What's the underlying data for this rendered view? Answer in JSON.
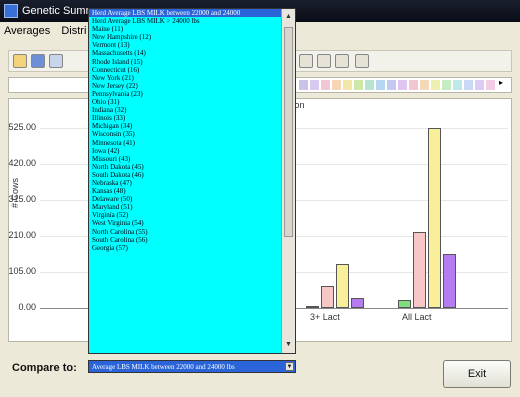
{
  "window": {
    "title": "Genetic Summ"
  },
  "menubar": {
    "items": [
      "Averages",
      "Distri"
    ]
  },
  "chart_data": {
    "type": "bar",
    "subtitle": "tion",
    "ylabel": "# Cows",
    "yticks": [
      "525.00",
      "420.00",
      "315.00",
      "210.00",
      "105.00",
      "0.00"
    ],
    "categories": [
      "3+ Lact",
      "All Lact"
    ],
    "ylim": [
      0,
      525
    ],
    "series": [
      {
        "values": [
          6,
          24
        ],
        "color": "#7fdc7f"
      },
      {
        "values": [
          65,
          222
        ],
        "color": "#f7c6c6"
      },
      {
        "values": [
          128,
          525
        ],
        "color": "#f9ef9b"
      },
      {
        "values": [
          30,
          158
        ],
        "color": "#b57bf0"
      }
    ]
  },
  "dropdown": {
    "items": [
      "Herd Average LBS MILK between 22000 and 24000",
      "Herd Average LBS MILK > 24000 lbs",
      "Maine (11)",
      "New Hampshire (12)",
      "Vermont (13)",
      "Massachusetts (14)",
      "Rhode Island (15)",
      "Connecticut (16)",
      "New York (21)",
      "New Jersey (22)",
      "Pennsylvania (23)",
      "Ohio (31)",
      "Indiana (32)",
      "Illinois (33)",
      "Michigan (34)",
      "Wisconsin (35)",
      "Minnesota (41)",
      "Iowa (42)",
      "Missouri (43)",
      "North Dakota (45)",
      "South Dakota (46)",
      "Nebraska (47)",
      "Kansas (48)",
      "Delaware (50)",
      "Maryland (51)",
      "Virginia (52)",
      "West Virginia (54)",
      "North Carolina (55)",
      "South Carolina (56)",
      "Georgia (57)"
    ],
    "selected_index": 0
  },
  "compare": {
    "label": "Compare to:",
    "value": "Average LBS MILK between 22000 and 24000 lbs"
  },
  "exit_label": "Exit"
}
